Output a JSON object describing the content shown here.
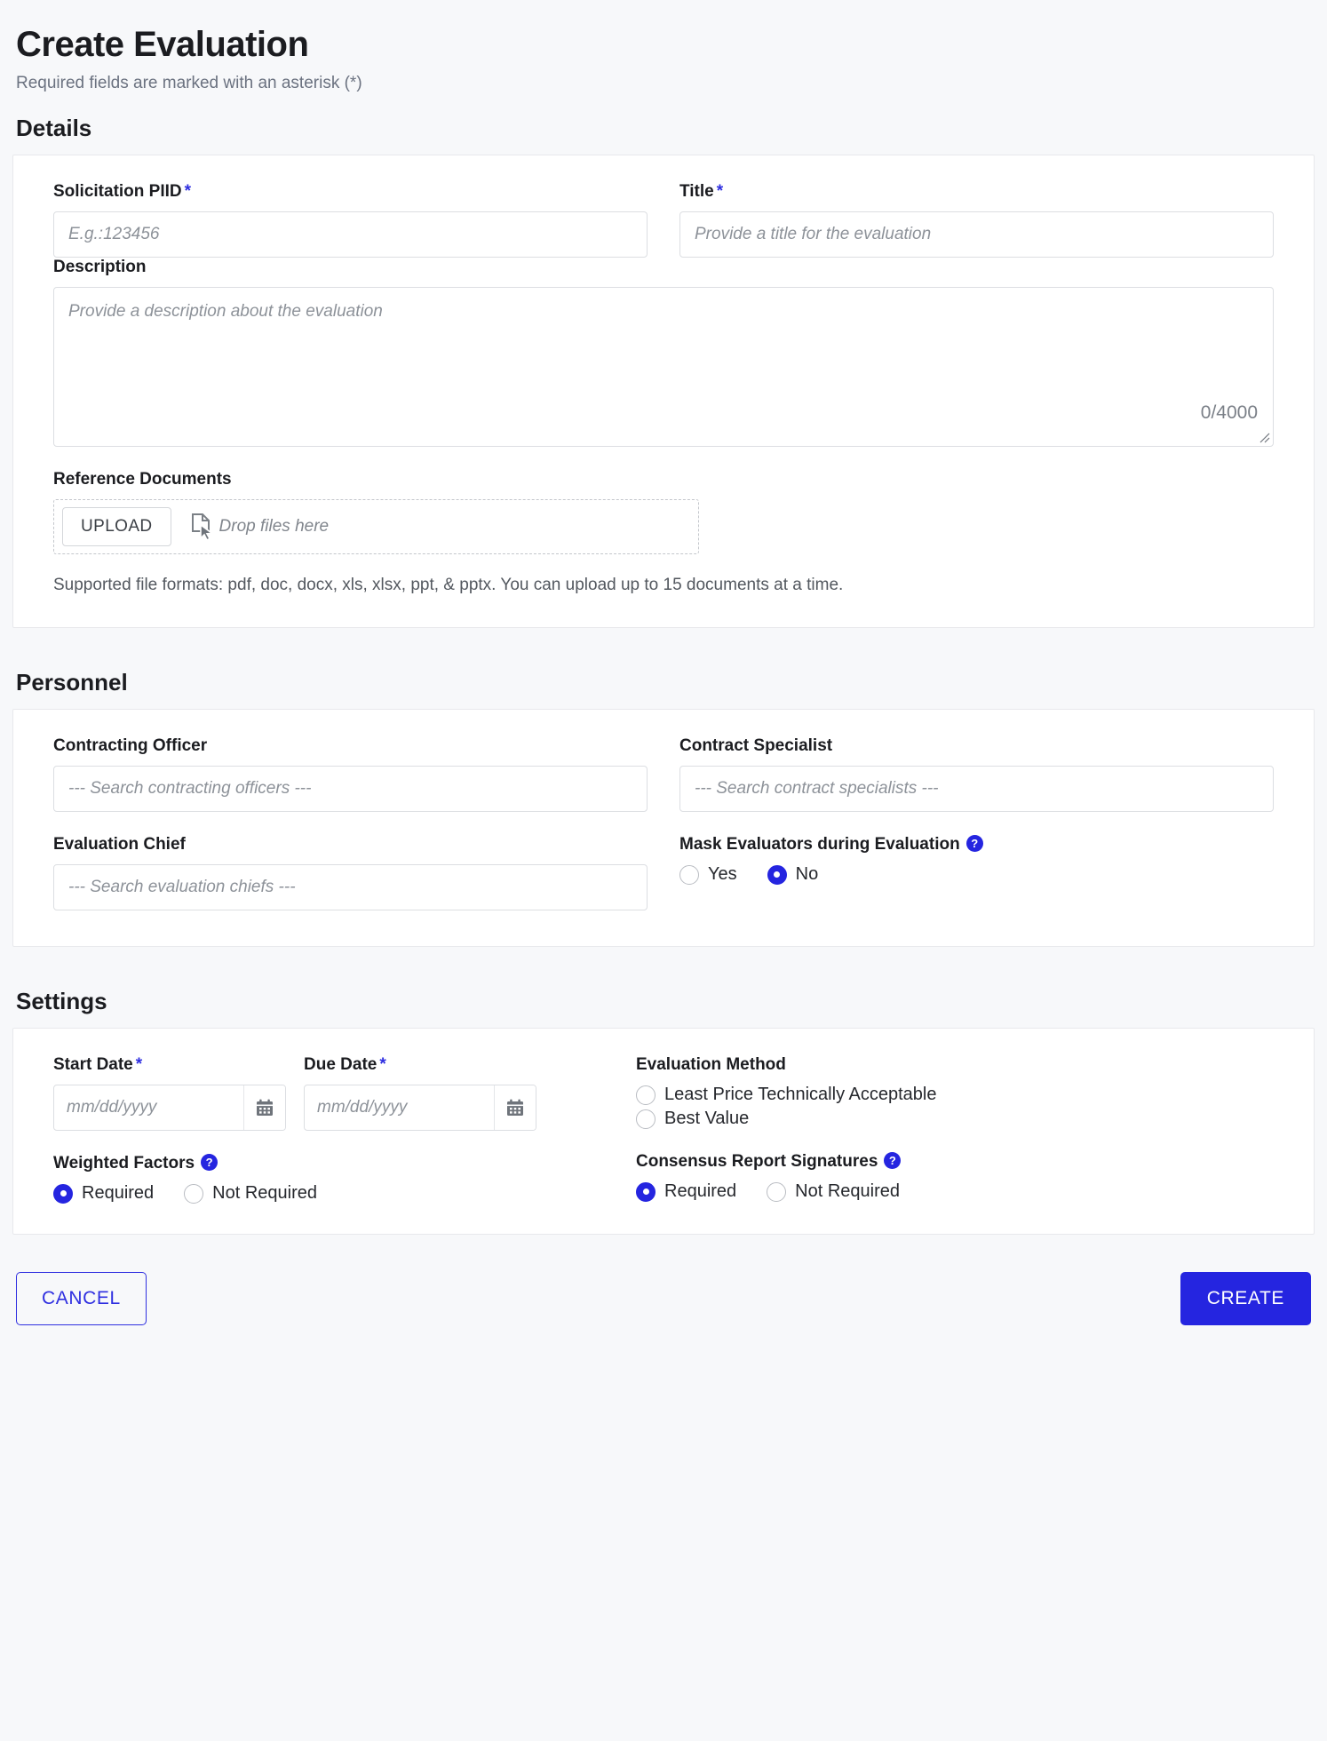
{
  "header": {
    "title": "Create Evaluation",
    "subtitle": "Required fields are marked with an asterisk (*)"
  },
  "accent_color": "#2525e0",
  "sections": {
    "details": "Details",
    "personnel": "Personnel",
    "settings": "Settings"
  },
  "details": {
    "solicitation": {
      "label": "Solicitation PIID",
      "required_marker": "*",
      "placeholder": "E.g.:123456",
      "value": ""
    },
    "title": {
      "label": "Title",
      "required_marker": "*",
      "placeholder": "Provide a title for the evaluation",
      "value": ""
    },
    "description": {
      "label": "Description",
      "placeholder": "Provide a description about the evaluation",
      "value": "",
      "counter": "0/4000"
    },
    "reference_documents": {
      "label": "Reference Documents",
      "upload_button": "UPLOAD",
      "drop_text": "Drop files here",
      "hint": "Supported file formats: pdf, doc, docx, xls, xlsx, ppt, & pptx. You can upload up to 15 documents at a time."
    }
  },
  "personnel": {
    "contracting_officer": {
      "label": "Contracting Officer",
      "placeholder": "--- Search contracting officers ---",
      "value": ""
    },
    "contract_specialist": {
      "label": "Contract Specialist",
      "placeholder": "--- Search contract specialists ---",
      "value": ""
    },
    "evaluation_chief": {
      "label": "Evaluation Chief",
      "placeholder": "--- Search evaluation chiefs ---",
      "value": ""
    },
    "mask_evaluators": {
      "label": "Mask Evaluators during Evaluation",
      "help": "?",
      "options": [
        {
          "label": "Yes",
          "selected": false
        },
        {
          "label": "No",
          "selected": true
        }
      ]
    }
  },
  "settings": {
    "start_date": {
      "label": "Start Date",
      "required_marker": "*",
      "placeholder": "mm/dd/yyyy",
      "value": ""
    },
    "due_date": {
      "label": "Due Date",
      "required_marker": "*",
      "placeholder": "mm/dd/yyyy",
      "value": ""
    },
    "evaluation_method": {
      "label": "Evaluation Method",
      "options": [
        {
          "label": "Least Price Technically Acceptable",
          "selected": false
        },
        {
          "label": "Best Value",
          "selected": false
        }
      ]
    },
    "weighted_factors": {
      "label": "Weighted Factors",
      "help": "?",
      "options": [
        {
          "label": "Required",
          "selected": true
        },
        {
          "label": "Not Required",
          "selected": false
        }
      ]
    },
    "consensus_report_signatures": {
      "label": "Consensus Report Signatures",
      "help": "?",
      "options": [
        {
          "label": "Required",
          "selected": true
        },
        {
          "label": "Not Required",
          "selected": false
        }
      ]
    }
  },
  "footer": {
    "cancel": "CANCEL",
    "create": "CREATE"
  }
}
